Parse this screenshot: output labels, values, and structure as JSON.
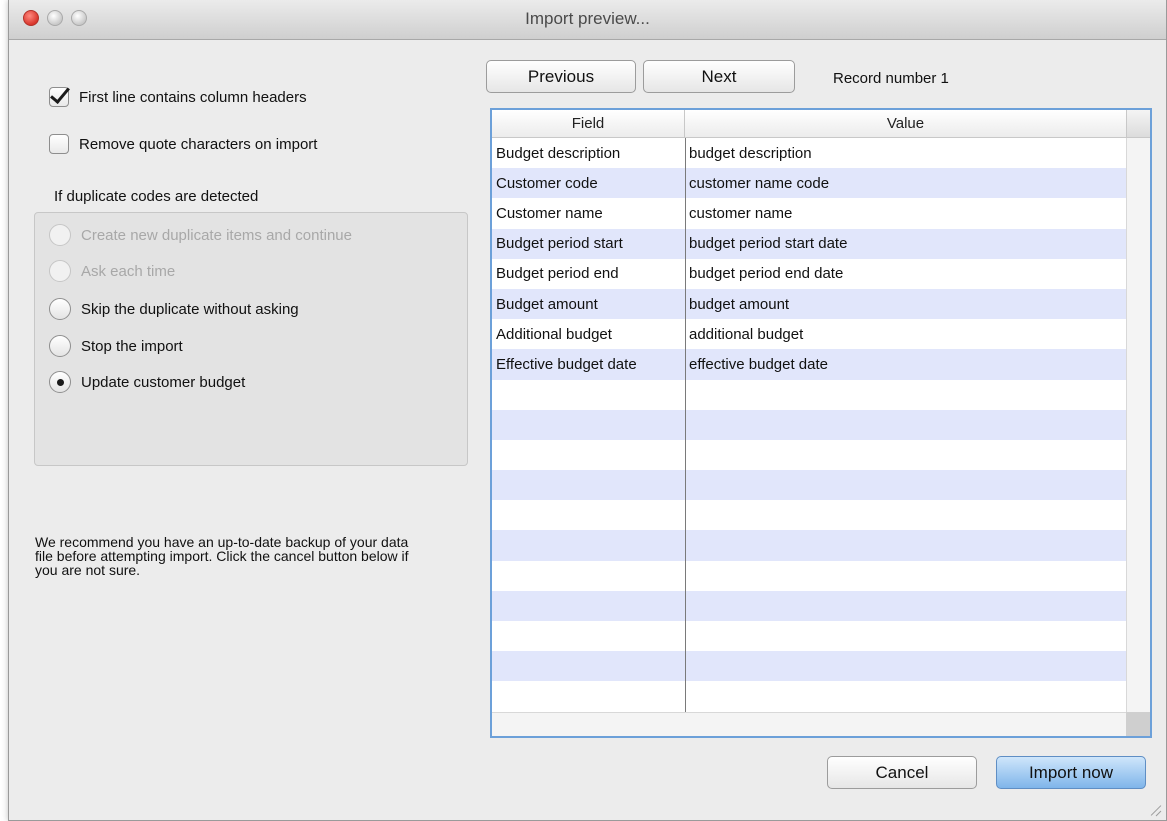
{
  "window": {
    "title": "Import preview..."
  },
  "options": {
    "first_line_headers": {
      "label": "First line contains column headers",
      "checked": true
    },
    "remove_quotes": {
      "label": "Remove quote characters on import",
      "checked": false
    }
  },
  "duplicates": {
    "title": "If duplicate codes are detected",
    "options": [
      {
        "label": "Create new duplicate items and continue",
        "enabled": false,
        "selected": false
      },
      {
        "label": "Ask each time",
        "enabled": false,
        "selected": false
      },
      {
        "label": "Skip the duplicate without asking",
        "enabled": true,
        "selected": false
      },
      {
        "label": "Stop the import",
        "enabled": true,
        "selected": false
      },
      {
        "label": "Update customer budget",
        "enabled": true,
        "selected": true
      }
    ]
  },
  "note": "We recommend you have an up-to-date backup of your data file before attempting import. Click the cancel button below if you are not sure.",
  "nav": {
    "previous": "Previous",
    "next": "Next",
    "record": "Record number 1"
  },
  "table": {
    "headers": {
      "field": "Field",
      "value": "Value"
    },
    "rows": [
      {
        "field": "Budget description",
        "value": "budget description"
      },
      {
        "field": "Customer code",
        "value": "customer name code"
      },
      {
        "field": "Customer name",
        "value": "customer name"
      },
      {
        "field": "Budget period start",
        "value": "budget period start date"
      },
      {
        "field": "Budget period end",
        "value": "budget period end date"
      },
      {
        "field": "Budget amount",
        "value": "budget amount"
      },
      {
        "field": "Additional budget",
        "value": "additional budget"
      },
      {
        "field": "Effective budget date",
        "value": "effective budget date"
      }
    ]
  },
  "footer": {
    "cancel": "Cancel",
    "import": "Import now"
  },
  "colors": {
    "accent": "#7fb5ea",
    "row_stripe": "#e1e6fb",
    "focus_border": "#6ca0d9"
  }
}
